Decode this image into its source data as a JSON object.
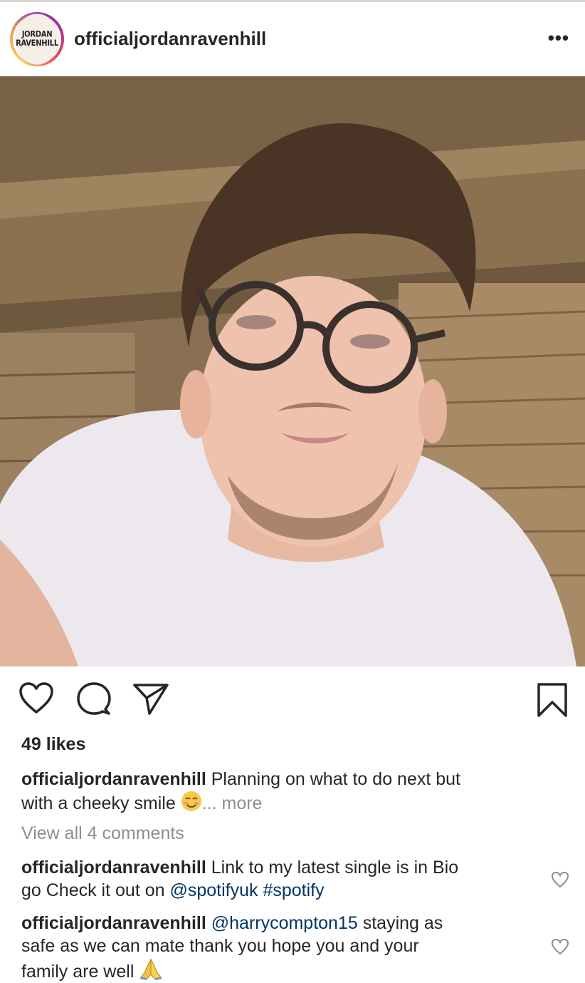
{
  "post": {
    "author": "officialjordanravenhill",
    "avatar_logo_lines": [
      "JORDAN",
      "RAVENHILL"
    ],
    "more_label": "•••",
    "image": {
      "description_icon": "selfie-photo"
    },
    "likes_text": "49 likes",
    "caption": {
      "author": "officialjordanravenhill",
      "text_line1": "Planning on what to do next but",
      "text_line2": "with a cheeky smile",
      "emoji": "smiling-face-icon",
      "ellipsis": "...",
      "more": "more"
    },
    "view_all_comments": "View all 4 comments",
    "comments": [
      {
        "author": "officialjordanravenhill",
        "text_a": "Link to my latest single is in Bio",
        "text_b": "go Check it out on",
        "mention": "@spotifyuk",
        "hashtag": "#spotify"
      },
      {
        "author": "officialjordanravenhill",
        "mention": "@harrycompton15",
        "text_a": "staying as",
        "text_b": "safe as we can mate thank you hope you and your",
        "text_c": "family are well",
        "emoji": "folded-hands-icon"
      }
    ]
  },
  "colors": {
    "text": "#262626",
    "muted": "#8e8e8e",
    "link": "#003569",
    "separator": "#d6d6d6"
  }
}
